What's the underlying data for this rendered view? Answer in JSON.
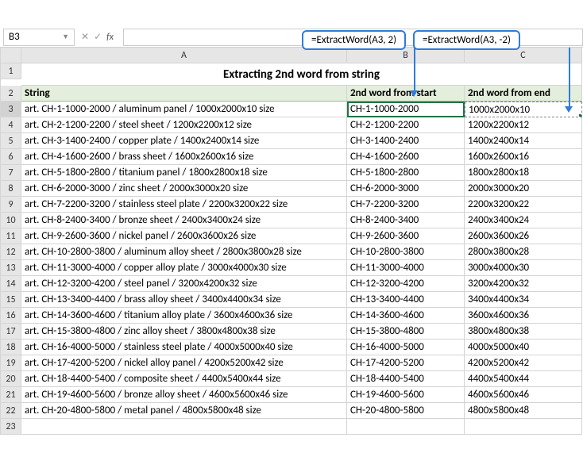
{
  "callouts": {
    "b": "=ExtractWord(A3, 2)",
    "c": "=ExtractWord(A3, -2)"
  },
  "formula_bar": {
    "name_box": "B3",
    "formula": ""
  },
  "columns": [
    "",
    "A",
    "B",
    "C"
  ],
  "title": "Extracting 2nd word from string",
  "headers": {
    "a": "String",
    "b": "2nd word from start",
    "c": "2nd word from end"
  },
  "rows": [
    {
      "n": "3",
      "a": "art. CH-1-1000-2000 / aluminum panel / 1000x2000x10 size",
      "b": "CH-1-1000-2000",
      "c": "1000x2000x10"
    },
    {
      "n": "4",
      "a": "art. CH-2-1200-2200 / steel sheet / 1200x2200x12 size",
      "b": "CH-2-1200-2200",
      "c": "1200x2200x12"
    },
    {
      "n": "5",
      "a": "art. CH-3-1400-2400 / copper plate / 1400x2400x14 size",
      "b": "CH-3-1400-2400",
      "c": "1400x2400x14"
    },
    {
      "n": "6",
      "a": "art. CH-4-1600-2600 / brass sheet / 1600x2600x16 size",
      "b": "CH-4-1600-2600",
      "c": "1600x2600x16"
    },
    {
      "n": "7",
      "a": "art. CH-5-1800-2800 / titanium panel / 1800x2800x18 size",
      "b": "CH-5-1800-2800",
      "c": "1800x2800x18"
    },
    {
      "n": "8",
      "a": "art. CH-6-2000-3000 / zinc sheet / 2000x3000x20 size",
      "b": "CH-6-2000-3000",
      "c": "2000x3000x20"
    },
    {
      "n": "9",
      "a": "art. CH-7-2200-3200 / stainless steel plate / 2200x3200x22 size",
      "b": "CH-7-2200-3200",
      "c": "2200x3200x22"
    },
    {
      "n": "10",
      "a": "art. CH-8-2400-3400 / bronze sheet / 2400x3400x24 size",
      "b": "CH-8-2400-3400",
      "c": "2400x3400x24"
    },
    {
      "n": "11",
      "a": "art. CH-9-2600-3600 / nickel panel / 2600x3600x26 size",
      "b": "CH-9-2600-3600",
      "c": "2600x3600x26"
    },
    {
      "n": "12",
      "a": "art. CH-10-2800-3800 / aluminum alloy sheet / 2800x3800x28 size",
      "b": "CH-10-2800-3800",
      "c": "2800x3800x28"
    },
    {
      "n": "13",
      "a": "art. CH-11-3000-4000 / copper alloy plate / 3000x4000x30 size",
      "b": "CH-11-3000-4000",
      "c": "3000x4000x30"
    },
    {
      "n": "14",
      "a": "art. CH-12-3200-4200 / steel panel / 3200x4200x32 size",
      "b": "CH-12-3200-4200",
      "c": "3200x4200x32"
    },
    {
      "n": "15",
      "a": "art. CH-13-3400-4400 / brass alloy sheet / 3400x4400x34 size",
      "b": "CH-13-3400-4400",
      "c": "3400x4400x34"
    },
    {
      "n": "16",
      "a": "art. CH-14-3600-4600 / titanium alloy plate / 3600x4600x36 size",
      "b": "CH-14-3600-4600",
      "c": "3600x4600x36"
    },
    {
      "n": "17",
      "a": "art. CH-15-3800-4800 / zinc alloy sheet / 3800x4800x38 size",
      "b": "CH-15-3800-4800",
      "c": "3800x4800x38"
    },
    {
      "n": "18",
      "a": "art. CH-16-4000-5000 / stainless steel plate / 4000x5000x40 size",
      "b": "CH-16-4000-5000",
      "c": "4000x5000x40"
    },
    {
      "n": "19",
      "a": "art. CH-17-4200-5200 / nickel alloy panel / 4200x5200x42 size",
      "b": "CH-17-4200-5200",
      "c": "4200x5200x42"
    },
    {
      "n": "20",
      "a": "art. CH-18-4400-5400 / composite sheet / 4400x5400x44 size",
      "b": "CH-18-4400-5400",
      "c": "4400x5400x44"
    },
    {
      "n": "21",
      "a": "art. CH-19-4600-5600 / bronze alloy sheet / 4600x5600x46 size",
      "b": "CH-19-4600-5600",
      "c": "4600x5600x46"
    },
    {
      "n": "22",
      "a": "art. CH-20-4800-5800 / metal panel / 4800x5800x48 size",
      "b": "CH-20-4800-5800",
      "c": "4800x5800x48"
    }
  ],
  "empty_row": "23"
}
